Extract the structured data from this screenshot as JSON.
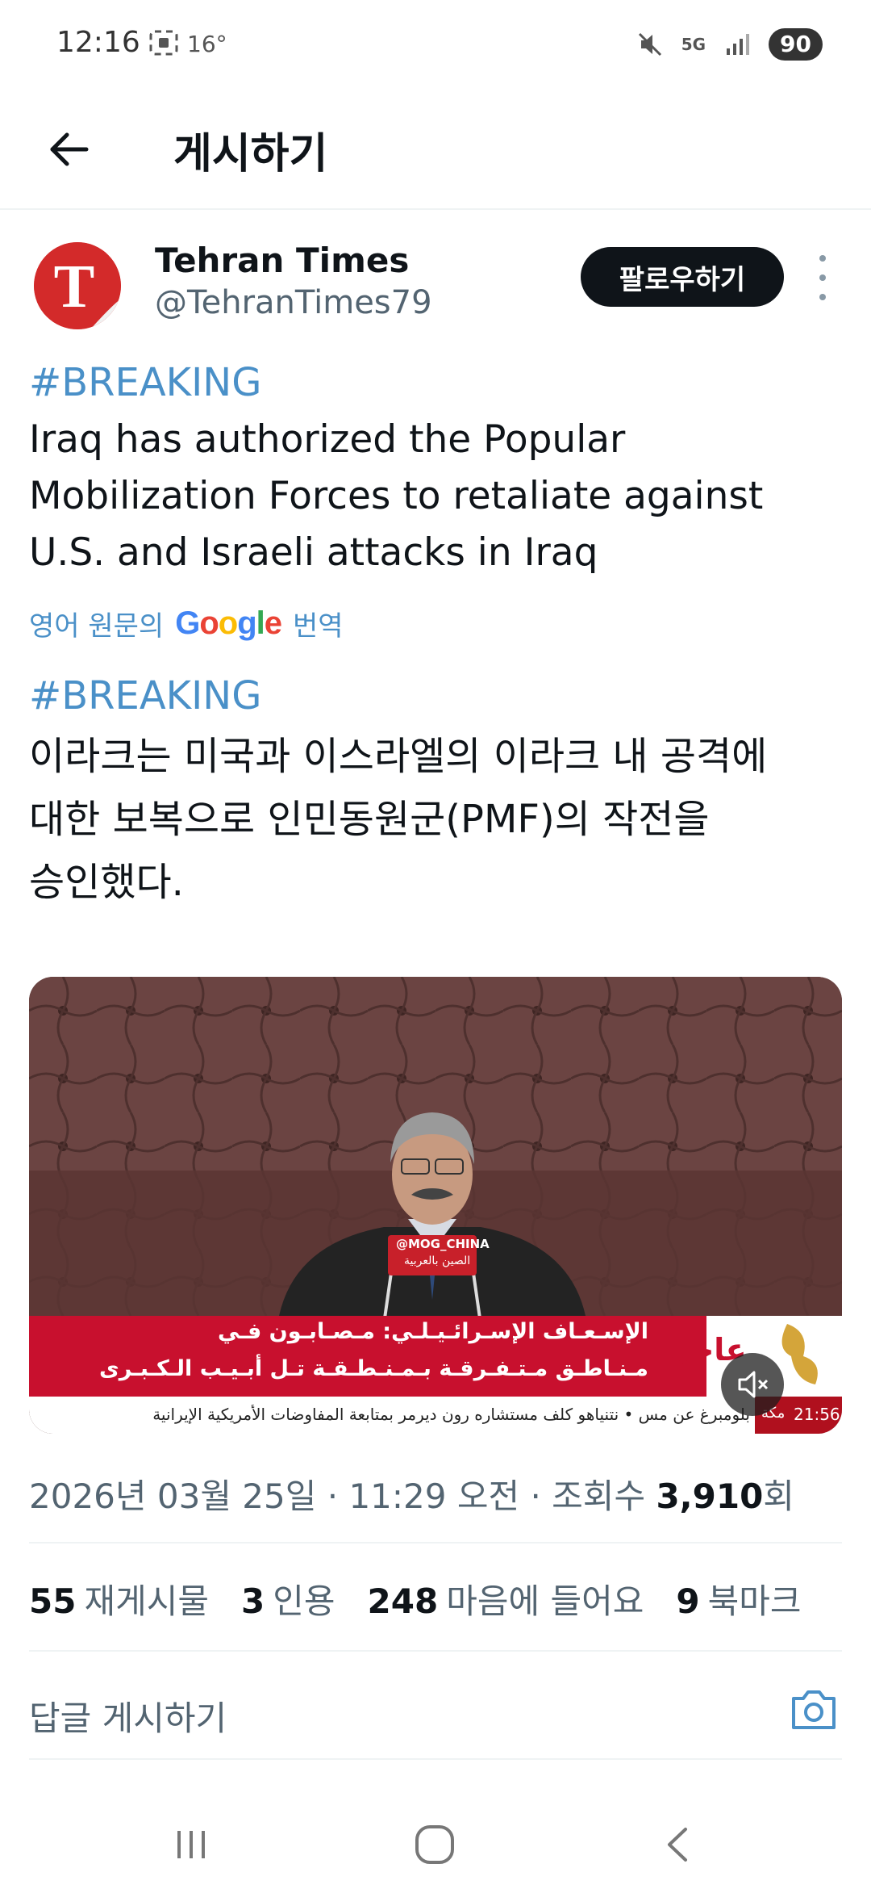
{
  "status_bar": {
    "time": "12:16",
    "temperature": "16°",
    "battery": "90",
    "network": "5G",
    "icons": [
      "screenshot-icon",
      "mute-icon",
      "5g-icon",
      "signal-icon",
      "battery-icon"
    ]
  },
  "header": {
    "title": "게시하기",
    "back_icon": "arrow-left-icon"
  },
  "post": {
    "author": {
      "name": "Tehran Times",
      "handle": "@TehranTimes79",
      "avatar_letter": "T"
    },
    "follow_label": "팔로우하기",
    "hashtag_1": "#BREAKING",
    "text_lines": [
      "Iraq has authorized the Popular",
      "Mobilization Forces to retaliate against",
      "U.S. and Israeli attacks in Iraq"
    ],
    "translate": {
      "prefix": "영어 원문의",
      "google": "Google",
      "suffix": "번역"
    },
    "hashtag_2": "#BREAKING",
    "translated_lines": [
      "이라크는 미국과 이스라엘의 이라크 내 공격에",
      "대한 보복으로 인민동원군(PMF)의 작전을",
      "승인했다."
    ],
    "media": {
      "mic_label_1": "@MOG_CHINA",
      "mic_label_2": "الصين بالعربية",
      "breaking_label": "عاجل",
      "headline_1": "الإسـعـاف الإسـرائـيـلـي: مـصـابـون فـي",
      "headline_2": "مـنـاطـق مـتـفـرقـة بـمـنـطـقـة تـل أبـيـب الـكـبـرى",
      "ticker": "بلومبرغ عن مس  •  نتنياهو كلف مستشاره رون ديرمر بمتابعة المفاوضات الأمريكية الإيرانية",
      "ticker_time": "21:56",
      "ticker_suffix": "مكة"
    },
    "meta": {
      "date": "2026년 03월 25일 · 11:29 오전 · 조회수 ",
      "views": "3,910",
      "views_suffix": "회"
    },
    "stats": [
      {
        "count": "55",
        "label": "재게시물"
      },
      {
        "count": "3",
        "label": "인용"
      },
      {
        "count": "248",
        "label": "마음에 들어요"
      },
      {
        "count": "9",
        "label": "북마크"
      }
    ]
  },
  "reply": {
    "placeholder": "답글 게시하기"
  },
  "colors": {
    "accent": "#4a90c8",
    "avatar_red": "#d32a2a",
    "text_primary": "#0f1419",
    "text_secondary": "#536471"
  }
}
